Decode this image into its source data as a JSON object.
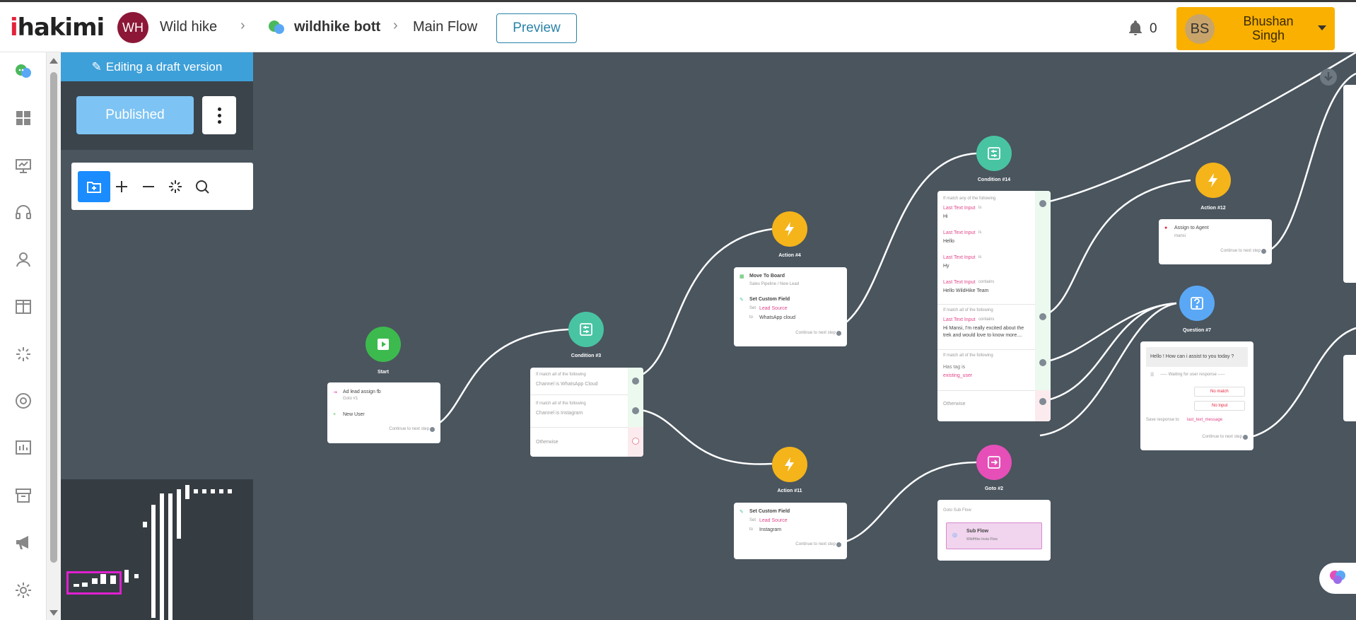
{
  "header": {
    "logo": "hakimi",
    "logo_prefix": "i",
    "workspace_initials": "WH",
    "workspace_name": "Wild hike",
    "bot_name": "wildhike bott",
    "flow_name": "Main Flow",
    "preview_label": "Preview",
    "notification_count": "0",
    "user_initials": "BS",
    "user_name": "Bhushan Singh"
  },
  "panel": {
    "draft_banner": "Editing a draft version",
    "published_label": "Published"
  },
  "nav_icons": [
    "chat-icon",
    "dashboard-icon",
    "presentation-icon",
    "headset-icon",
    "user-icon",
    "columns-icon",
    "spark-icon",
    "lifebuoy-icon",
    "report-icon",
    "archive-icon",
    "megaphone-icon",
    "settings-icon"
  ],
  "toolbar": [
    "add-folder-icon",
    "zoom-in-icon",
    "zoom-out-icon",
    "fit-icon",
    "search-icon"
  ],
  "flow": {
    "start": {
      "label": "Start",
      "line1": "Ad lead assign fb",
      "line1_sub": "Goto #1",
      "line2": "New User",
      "continue": "Continue to next step"
    },
    "condition3": {
      "label": "Condition #3",
      "r1_head": "If match all of the following",
      "r1_body": "Channel is WhatsApp Cloud",
      "r2_head": "If match all of the following",
      "r2_body": "Channel is Instagram",
      "otherwise": "Otherwise"
    },
    "action4": {
      "label": "Action #4",
      "a1_title": "Move To Board",
      "a1_sub": "Sales Pipeline / New Lead",
      "a2_title": "Set Custom Field",
      "a2_set": "Set",
      "a2_field": "Lead Source",
      "a2_to": "to",
      "a2_value": "WhatsApp cloud",
      "continue": "Continue to next step"
    },
    "action11": {
      "label": "Action #11",
      "a1_title": "Set Custom Field",
      "a1_set": "Set",
      "a1_field": "Lead Source",
      "a1_to": "to",
      "a1_value": "Instagram",
      "continue": "Continue to next step"
    },
    "condition14": {
      "label": "Condition #14",
      "g1_head": "If match any of the following",
      "c1_field": "Last Text Input",
      "c1_op": "is",
      "c1_val": "Hi",
      "c2_field": "Last Text Input",
      "c2_op": "is",
      "c2_val": "Hello",
      "c3_field": "Last Text Input",
      "c3_op": "is",
      "c3_val": "Hy",
      "c4_field": "Last Text Input",
      "c4_op": "contains",
      "c4_val": "Hello WildHike Team",
      "g2_head": "If match all of the following",
      "c5_field": "Last Text Input",
      "c5_op": "contains",
      "c5_val1": "Hi Mansi, I'm really excited about the",
      "c5_val2": "trek and would love to know more....",
      "g3_head": "If match all of the following",
      "c6_label": "Has tag is",
      "c6_val": "existing_user",
      "otherwise": "Otherwise"
    },
    "goto2": {
      "label": "Goto #2",
      "title": "Goto Sub Flow",
      "sub_name": "Sub Flow",
      "sub_desc": "WildHike Insta Flow"
    },
    "action12": {
      "label": "Action #12",
      "title": "Assign to Agent",
      "agent": "mansi",
      "continue": "Continue to next step"
    },
    "question7": {
      "label": "Question #7",
      "prompt": "Hello ! How can i assist to you today ?",
      "waiting": "----- Waiting for user response -----",
      "no_match": "No match",
      "no_input": "No input",
      "save_label": "Save response to",
      "save_field": "last_text_message",
      "continue": "Continue to next step"
    }
  },
  "colors": {
    "canvas": "#4a555e",
    "start": "#3dba4e",
    "condition": "#49c4a2",
    "action": "#f4b41a",
    "goto": "#e64fb8",
    "question": "#5aa8f5",
    "accent": "#1a8cff",
    "brand_red": "#e4233b"
  }
}
